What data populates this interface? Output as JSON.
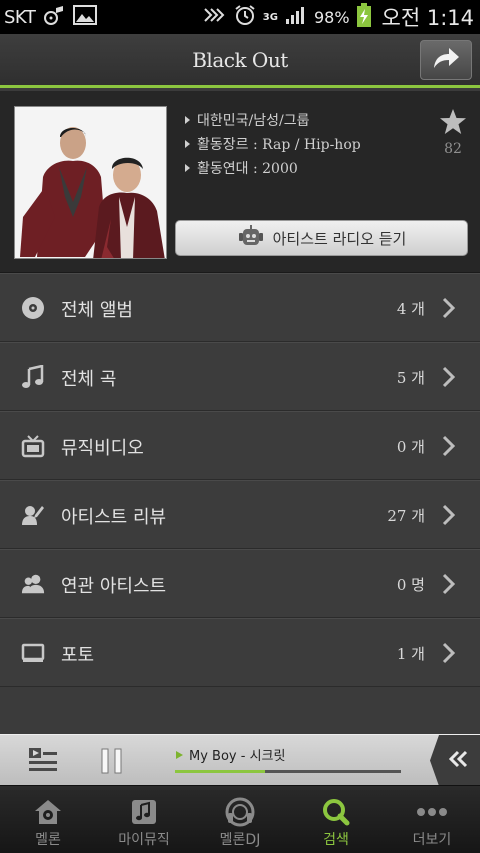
{
  "status_bar": {
    "carrier": "SKT",
    "network": "3G",
    "battery": "98%",
    "time": "오전 1:14"
  },
  "header": {
    "title": "Black Out"
  },
  "artist": {
    "info": [
      "대한민국/남성/그룹",
      "활동장르 : Rap / Hip-hop",
      "활동연대 : 2000"
    ],
    "star_count": "82",
    "radio_button": "아티스트 라디오 듣기"
  },
  "menu": [
    {
      "label": "전체 앨범",
      "count": "4 개",
      "icon": "disc-icon"
    },
    {
      "label": "전체 곡",
      "count": "5 개",
      "icon": "music-note-icon"
    },
    {
      "label": "뮤직비디오",
      "count": "0 개",
      "icon": "tv-icon"
    },
    {
      "label": "아티스트 리뷰",
      "count": "27 개",
      "icon": "review-icon"
    },
    {
      "label": "연관 아티스트",
      "count": "0 명",
      "icon": "related-artists-icon"
    },
    {
      "label": "포토",
      "count": "1 개",
      "icon": "photo-icon"
    }
  ],
  "player": {
    "track": "My Boy - 시크릿",
    "progress": 0.4
  },
  "tabs": [
    {
      "label": "멜론",
      "icon": "home-icon",
      "active": false
    },
    {
      "label": "마이뮤직",
      "icon": "my-music-icon",
      "active": false
    },
    {
      "label": "멜론DJ",
      "icon": "headphones-icon",
      "active": false
    },
    {
      "label": "검색",
      "icon": "search-icon",
      "active": true
    },
    {
      "label": "더보기",
      "icon": "more-icon",
      "active": false
    }
  ],
  "colors": {
    "accent": "#8cc63f",
    "background": "#3c3c3c"
  }
}
